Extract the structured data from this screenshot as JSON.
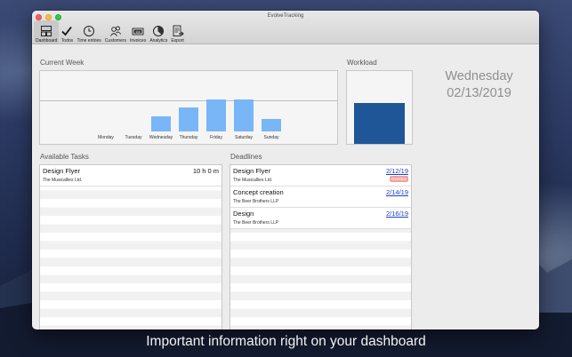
{
  "window": {
    "title": "EvolveTracking"
  },
  "toolbar": {
    "items": [
      {
        "label": "Dashboard",
        "icon": "dashboard-icon",
        "active": true
      },
      {
        "label": "Todos",
        "icon": "checkmark-icon"
      },
      {
        "label": "Time entries",
        "icon": "clock-icon"
      },
      {
        "label": "Customers",
        "icon": "customers-icon"
      },
      {
        "label": "Invoices",
        "icon": "invoice-icon"
      },
      {
        "label": "Analytics",
        "icon": "analytics-icon"
      },
      {
        "label": "Export",
        "icon": "export-icon"
      }
    ]
  },
  "current_week": {
    "label": "Current Week",
    "days": [
      "Monday",
      "Tuesday",
      "Wednesday",
      "Thursday",
      "Friday",
      "Saturday",
      "Sunday"
    ],
    "bar_levels": [
      0,
      0,
      0.48,
      0.75,
      1.0,
      1.0,
      0.4
    ],
    "bar_color": "#79b6f7"
  },
  "workload": {
    "label": "Workload",
    "level": 1.0,
    "color": "#1f5698"
  },
  "date_display": {
    "weekday": "Wednesday",
    "date": "02/13/2019"
  },
  "available_tasks": {
    "label": "Available Tasks",
    "items": [
      {
        "name": "Design Flyer",
        "customer": "The Musicallies Ltd.",
        "hours": "10 h 0 m"
      }
    ]
  },
  "deadlines": {
    "label": "Deadlines",
    "items": [
      {
        "name": "Design Flyer",
        "customer": "The Musicallies Ltd.",
        "date": "2/12/19",
        "badge": "Overdue"
      },
      {
        "name": "Concept creation",
        "customer": "The Beer Brothers LLP",
        "date": "2/14/19"
      },
      {
        "name": "Design",
        "customer": "The Beer Brothers LLP",
        "date": "2/16/19"
      }
    ],
    "date_color": "#1a3fc8",
    "badge_color": "#f0a1a1"
  },
  "caption": "Important information right on your dashboard"
}
